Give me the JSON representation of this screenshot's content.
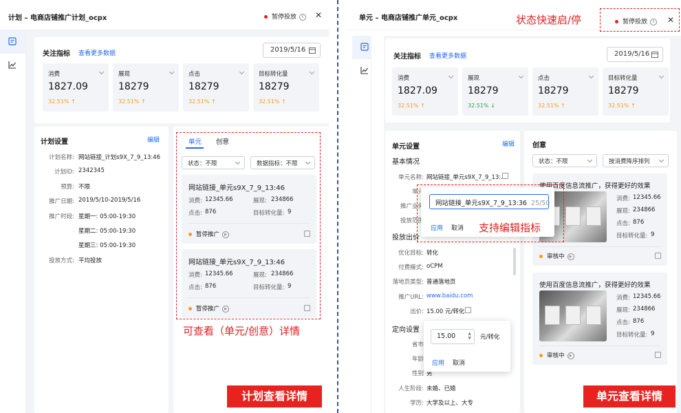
{
  "left": {
    "title": "计划 – 电商店铺推广计划_ocpx",
    "status": "暂停投放",
    "metrics_title": "关注指标",
    "more_link": "查看更多数据",
    "date": "2019/5/16",
    "metrics": [
      {
        "label": "消费",
        "value": "1827.09",
        "pct": "32.51%",
        "arrow": "↑"
      },
      {
        "label": "展现",
        "value": "18279",
        "pct": "32.51%",
        "arrow": "↑"
      },
      {
        "label": "点击",
        "value": "18279",
        "pct": "32.51%",
        "arrow": "↑"
      },
      {
        "label": "目标转化量",
        "value": "18279",
        "pct": "32.51%",
        "arrow": "↑"
      }
    ],
    "settings_title": "计划设置",
    "edit": "编辑",
    "settings": [
      {
        "label": "计划名称:",
        "value": "网站链接_计划s9X_7_9_13:46"
      },
      {
        "label": "计划ID:",
        "value": "2342345"
      },
      {
        "label": "预算:",
        "value": "不限"
      },
      {
        "label": "推广日期:",
        "value": "2019/5/10-2019/5/16"
      },
      {
        "label": "推广时段:",
        "value": "星期一: 05:00-19:30"
      },
      {
        "label": "",
        "value": "星期二: 05:00-19:30"
      },
      {
        "label": "",
        "value": "星期三: 05:00-19:30"
      },
      {
        "label": "投放方式:",
        "value": "平均投放"
      }
    ],
    "tabs": [
      "单元",
      "创意"
    ],
    "filters": [
      "状态：不限",
      "数据指标：不限"
    ],
    "units": [
      {
        "title": "网站链接_单元s9X_7_9_13:46",
        "r1l": "消费:",
        "r1v": "12345.66",
        "r1l2": "展现:",
        "r1v2": "234866",
        "r2l": "点击:",
        "r2v": "876",
        "r2l2": "目标转化量:",
        "r2v2": "9",
        "status": "暂停推广"
      },
      {
        "title": "网站链接_单元s9X_7_9_13:46",
        "r1l": "消费:",
        "r1v": "12345.66",
        "r1l2": "展现:",
        "r1v2": "234866",
        "r2l": "点击:",
        "r2v": "876",
        "r2l2": "目标转化量:",
        "r2v2": "9",
        "status": "暂停推广"
      }
    ],
    "annotation": "可查看（单元/创意）详情",
    "banner": "计划查看详情"
  },
  "right": {
    "title": "单元 – 电商店铺推广单元_ocpx",
    "status": "暂停投放",
    "annotation_status": "状态快速启/停",
    "metrics_title": "关注指标",
    "more_link": "查看更多数据",
    "date": "2019/5/16",
    "metrics": [
      {
        "label": "消费",
        "value": "1827.09",
        "pct": "32.51%",
        "arrow": "↑"
      },
      {
        "label": "展现",
        "value": "18279",
        "pct": "32.51%",
        "arrow": "↓"
      },
      {
        "label": "点击",
        "value": "18279",
        "pct": "32.51%",
        "arrow": "↑"
      },
      {
        "label": "目标转化量",
        "value": "18279",
        "pct": "32.51%",
        "arrow": "↑"
      }
    ],
    "settings_title": "单元设置",
    "edit": "编辑",
    "basic_title": "基本情况",
    "unit_name_label": "单元名称:",
    "unit_name_value": "网站链接_单元s9X_7_9_13:...",
    "unit_label2": "单元",
    "business_label": "推广业务",
    "scope_label": "投放范围",
    "bid_title": "投放出价",
    "bid_rows": [
      {
        "label": "优化目标:",
        "value": "转化"
      },
      {
        "label": "付费模式:",
        "value": "oCPM"
      },
      {
        "label": "落地页类型:",
        "value": "普通落地页"
      },
      {
        "label": "推广URL:",
        "value": "www.baidu.com"
      },
      {
        "label": "出价:",
        "value": "15.00 元/转化"
      }
    ],
    "target_title": "定向设置",
    "target_rows": [
      {
        "label": "省市",
        "value": ""
      },
      {
        "label": "年龄",
        "value": ""
      },
      {
        "label": "性别",
        "value": "男"
      },
      {
        "label": "人生阶段:",
        "value": "未婚、已婚"
      },
      {
        "label": "学历:",
        "value": "大学及以上、大专"
      }
    ],
    "popup1": {
      "value": "网站链接_单元s9X_7_9_13:36",
      "count": "25/50",
      "apply": "应用",
      "cancel": "取消"
    },
    "annotation_edit": "支持编辑指标",
    "popup2": {
      "value": "15.00",
      "unit": "元/转化",
      "apply": "应用",
      "cancel": "取消"
    },
    "creative_title": "创意",
    "filters": [
      "状态：不限",
      "按消费降序排列"
    ],
    "creatives": [
      {
        "title": "使用百度信息流推广，获得更好的效果",
        "r1l": "消费:",
        "r1v": "12345.66",
        "r2l": "展现:",
        "r2v": "234866",
        "r3l": "点击:",
        "r3v": "876",
        "r4l": "目标转化量:",
        "r4v": "9",
        "status": "审核中"
      },
      {
        "title": "使用百度信息流推广，获得更好的效果",
        "r1l": "消费:",
        "r1v": "12345.66",
        "r2l": "展现:",
        "r2v": "234866",
        "r3l": "点击:",
        "r3v": "876",
        "r4l": "目标转化量:",
        "r4v": "9",
        "status": "审核中"
      }
    ],
    "banner": "单元查看详情"
  },
  "colors": {
    "accent": "#2468f2",
    "annotation": "#e02020",
    "banner": "#e8231f",
    "up": "#f29d1a",
    "down": "#26a64b"
  }
}
